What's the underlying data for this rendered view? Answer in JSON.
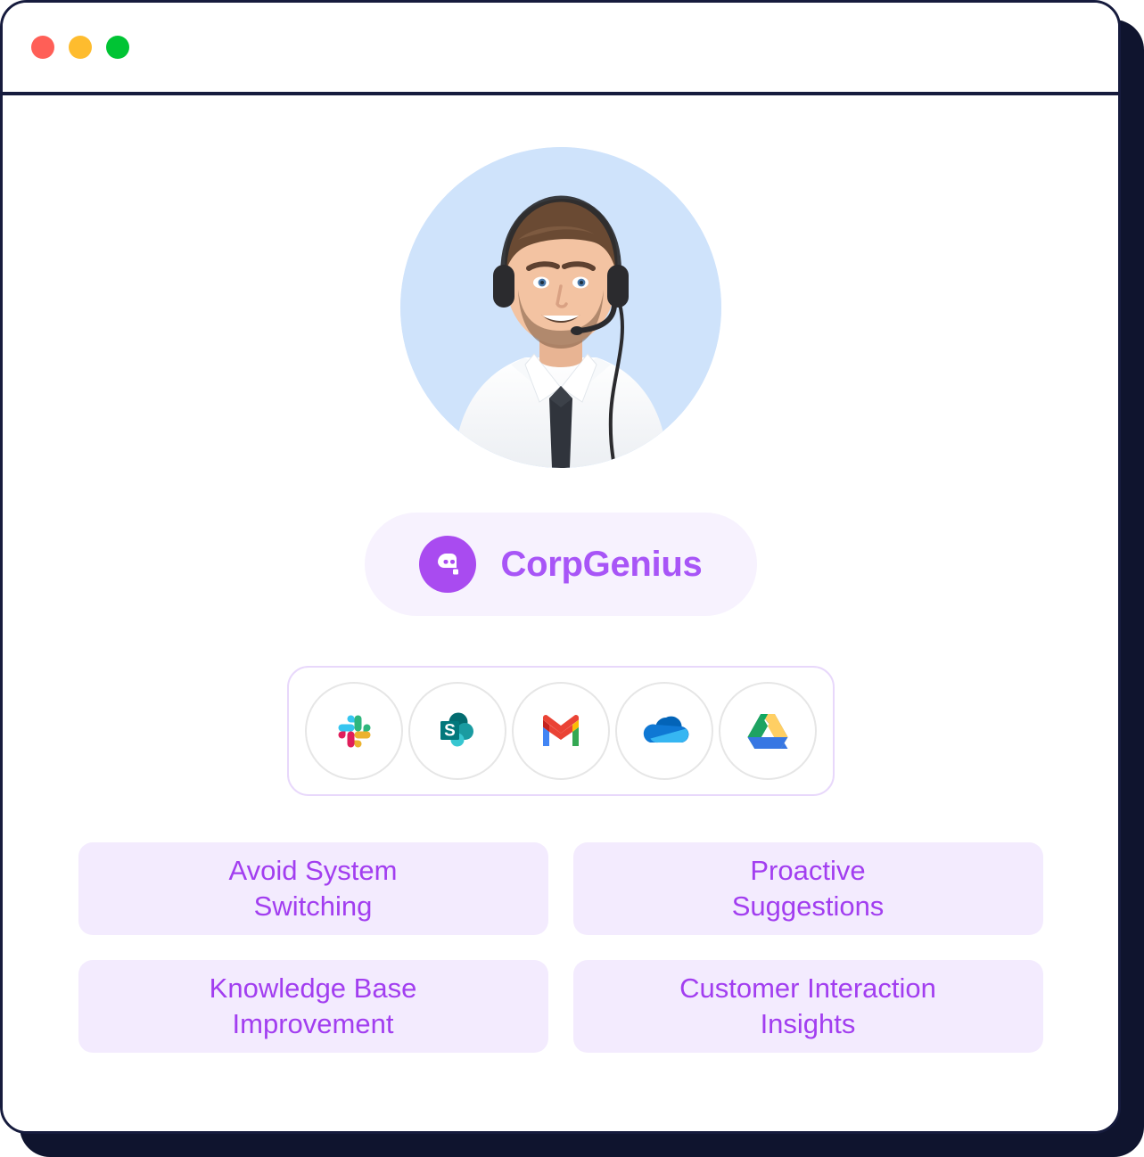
{
  "window": {
    "titlebar": {
      "dots": [
        {
          "name": "close-button",
          "color": "#ff5f57"
        },
        {
          "name": "minimize-button",
          "color": "#febc2e"
        },
        {
          "name": "maximize-button",
          "color": "#00c434"
        }
      ]
    }
  },
  "hero": {
    "avatar_alt": "Smiling support agent wearing a headset",
    "avatar_background": "#cfe3fb"
  },
  "brand": {
    "name": "CorpGenius",
    "logo_icon": "chat-bubble-robot-icon",
    "accent_color": "#a855f7",
    "pill_background": "#f7f2fe"
  },
  "integrations": {
    "border_color": "#e8d8fb",
    "items": [
      {
        "label": "Slack",
        "icon": "slack-icon"
      },
      {
        "label": "SharePoint",
        "icon": "sharepoint-icon"
      },
      {
        "label": "Gmail",
        "icon": "gmail-icon"
      },
      {
        "label": "OneDrive",
        "icon": "onedrive-icon"
      },
      {
        "label": "Google Drive",
        "icon": "google-drive-icon"
      }
    ]
  },
  "features": {
    "card_background": "#f3ebfe",
    "text_color": "#a23ef0",
    "cards": [
      {
        "label": "Avoid System\nSwitching"
      },
      {
        "label": "Proactive\nSuggestions"
      },
      {
        "label": "Knowledge Base\nImprovement"
      },
      {
        "label": "Customer Interaction\nInsights"
      }
    ]
  }
}
